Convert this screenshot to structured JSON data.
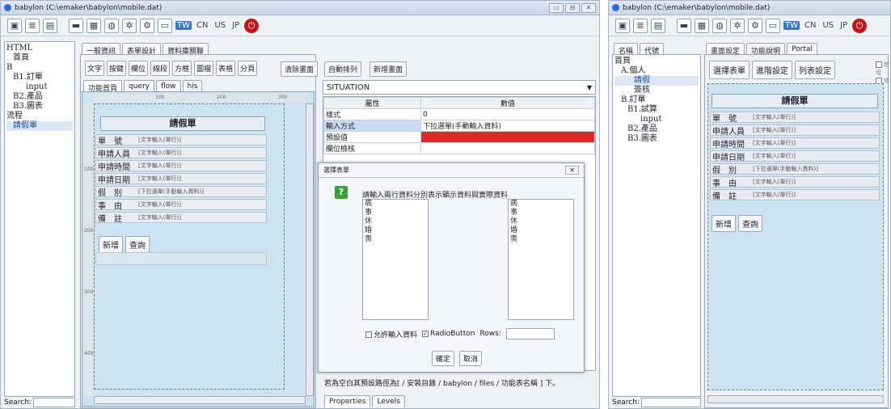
{
  "left_window": {
    "title": "babylon (C:\\emaker\\babylon\\mobile.dat)",
    "win_buttons": [
      "▭",
      "⊟",
      "✕"
    ],
    "toolbar_icons": [
      {
        "name": "window-icon",
        "glyph": "▣"
      },
      {
        "name": "database-icon",
        "glyph": "≣"
      },
      {
        "name": "document-icon",
        "glyph": "▤"
      },
      {
        "name": "folder-icon",
        "glyph": "▬"
      },
      {
        "name": "grid-icon",
        "glyph": "▦"
      },
      {
        "name": "browser-icon",
        "glyph": "◍"
      },
      {
        "name": "code-icon",
        "glyph": "✲"
      },
      {
        "name": "settings-icon",
        "glyph": "⚙"
      },
      {
        "name": "monitor-icon",
        "glyph": "▭"
      }
    ],
    "langs": [
      "TW",
      "CN",
      "US",
      "JP"
    ],
    "tree": [
      {
        "text": "HTML",
        "indent": 0,
        "sel": false
      },
      {
        "text": "首頁",
        "indent": 1,
        "sel": false
      },
      {
        "text": "B",
        "indent": 0,
        "sel": false
      },
      {
        "text": "B1.訂單",
        "indent": 1,
        "sel": false
      },
      {
        "text": "input",
        "indent": 3,
        "sel": false
      },
      {
        "text": "B2.產品",
        "indent": 1,
        "sel": false
      },
      {
        "text": "B3.圖表",
        "indent": 1,
        "sel": false
      },
      {
        "text": "流程",
        "indent": 0,
        "sel": false
      },
      {
        "text": "請假單",
        "indent": 1,
        "sel": true
      }
    ],
    "search_label": "Search:",
    "main_tabs": [
      "一般資訊",
      "表單設計",
      "資料庫關聯"
    ],
    "design_buttons": [
      "文字",
      "按鍵",
      "欄位",
      "線段",
      "方框",
      "圖檔",
      "表格",
      "分頁"
    ],
    "clear_button": "清除畫面",
    "auto_button": "自動排列",
    "add_button": "新增畫面",
    "sub_tabs": [
      "功能首頁",
      "query",
      "flow",
      "his"
    ],
    "ruler_marks": [
      "100",
      "200",
      "300"
    ],
    "ruler_side": [
      "100",
      "200",
      "300",
      "400"
    ],
    "form_title": "請假單",
    "form_rows": [
      {
        "label": "單　號",
        "value": "[文字輸入(單行)]"
      },
      {
        "label": "申請人員",
        "value": "[文字輸入(單行)]"
      },
      {
        "label": "申請時間",
        "value": "[文字輸入(單行)]"
      },
      {
        "label": "申請日期",
        "value": "[文字輸入(單行)]"
      },
      {
        "label": "假　別",
        "value": "[下拉選單(手動輸入資料)]"
      },
      {
        "label": "事　由",
        "value": "[文字輸入(單行)]"
      },
      {
        "label": "備　註",
        "value": "[文字輸入(單行)]"
      }
    ],
    "form_buttons": [
      "新增",
      "查詢"
    ],
    "situation": "SITUATION",
    "prop_headers": [
      "屬性",
      "數值"
    ],
    "props": [
      {
        "k": "樣式",
        "v": "0"
      },
      {
        "k": "輸入方式",
        "v": "下拉選單(手動輸入資料)"
      },
      {
        "k": "預設值",
        "v": ""
      },
      {
        "k": "欄位檢核",
        "v": ""
      }
    ],
    "dialog": {
      "title": "選擇表單",
      "hint": "請輸入兩行資料分別表示顯示資料與實際資料",
      "left_items": [
        "病",
        "事",
        "休",
        "婚",
        "喪"
      ],
      "right_items": [
        "病",
        "事",
        "休",
        "婚",
        "喪"
      ],
      "allow_input": "允許輸入資料",
      "radio": "RadioButton",
      "rows": "Rows:",
      "ok": "確定",
      "cancel": "取消"
    },
    "status_text": "若為空白其預設路徑為[ / 安裝目錄 / babylon / files / 功能表名稱 ] 下。",
    "bottom_tabs": [
      "Properties",
      "Levels"
    ]
  },
  "right_window": {
    "title": "babylon (C:\\emaker\\babylon\\mobile.dat)",
    "left_tabs": [
      "名稱",
      "代號"
    ],
    "tree": [
      {
        "text": "首頁",
        "indent": 0,
        "sel": false
      },
      {
        "text": "A.個人",
        "indent": 1,
        "sel": false
      },
      {
        "text": "請假",
        "indent": 3,
        "sel": true
      },
      {
        "text": "簽核",
        "indent": 3,
        "sel": false
      },
      {
        "text": "B.訂單",
        "indent": 1,
        "sel": false
      },
      {
        "text": "B1.試算",
        "indent": 2,
        "sel": false
      },
      {
        "text": "input",
        "indent": 4,
        "sel": false
      },
      {
        "text": "B2.產品",
        "indent": 2,
        "sel": false
      },
      {
        "text": "B3.圖表",
        "indent": 2,
        "sel": false
      }
    ],
    "search_label": "Search:",
    "main_tabs": [
      "畫面設定",
      "功能說明",
      "Portal"
    ],
    "buttons": [
      "選擇表單",
      "進階設定",
      "列表設定"
    ],
    "checks": [
      "新增",
      "修改"
    ],
    "form_title": "請假單",
    "form_rows": [
      {
        "label": "單　號",
        "value": "[文字輸入(單行)]"
      },
      {
        "label": "申請人員",
        "value": "[文字輸入(單行)]"
      },
      {
        "label": "申請時間",
        "value": "[文字輸入(單行)]"
      },
      {
        "label": "申請日期",
        "value": "[文字輸入(單行)]"
      },
      {
        "label": "假　別",
        "value": "[下拉選單(手動輸入資料)]"
      },
      {
        "label": "事　由",
        "value": "[文字輸入(單行)]"
      },
      {
        "label": "備　註",
        "value": "[文字輸入(單行)]"
      }
    ],
    "form_buttons": [
      "新增",
      "查詢"
    ]
  }
}
